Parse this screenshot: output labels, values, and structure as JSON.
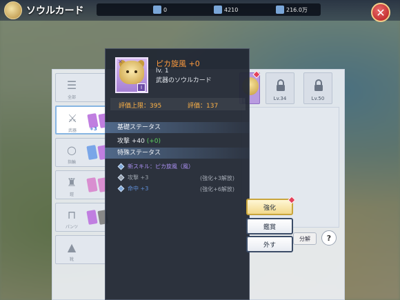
{
  "header": {
    "title": "ソウルカード",
    "resources": [
      {
        "icon": "coin-icon",
        "value": "0",
        "color": "#7aa6d8"
      },
      {
        "icon": "gem-icon",
        "value": "4210",
        "color": "#7aa6d8"
      },
      {
        "icon": "crystal-icon",
        "value": "216.0万",
        "color": "#7aa6d8"
      }
    ]
  },
  "slots": [
    {
      "label": "全部",
      "icon": "list-icon"
    },
    {
      "label": "武器",
      "icon": "sword-icon",
      "bonus": "+3"
    },
    {
      "label": "指輪",
      "icon": "ring-icon"
    },
    {
      "label": "鎧",
      "icon": "armor-icon"
    },
    {
      "label": "パンツ",
      "icon": "pants-icon"
    },
    {
      "label": "靴",
      "icon": "boots-icon"
    }
  ],
  "locked": [
    {
      "level": "Lv.34"
    },
    {
      "level": "Lv.50"
    }
  ],
  "card": {
    "name": "ピカ旋風 +0",
    "level": "lv. 1",
    "type": "武器のソウルカード",
    "rank": "I",
    "eval_max": "評価上限：395",
    "eval": "評価：137"
  },
  "basic": {
    "header": "基礎ステータス",
    "stat": "攻撃 +40",
    "bonus": "(+0)"
  },
  "special": {
    "header": "特殊ステータス",
    "lines": [
      {
        "text": "新スキル：ピカ旋風（風）",
        "note": "",
        "color": "#a98ff0"
      },
      {
        "text": "攻撃 +3",
        "note": "(強化+3解放)",
        "color": "#9aa1ab"
      },
      {
        "text": "命中 +3",
        "note": "(強化+6解放)",
        "color": "#5f8fd8"
      }
    ]
  },
  "buttons": {
    "enhance": "強化",
    "appraise": "鑑賞",
    "remove": "外す",
    "decompose": "分解",
    "help": "?"
  }
}
